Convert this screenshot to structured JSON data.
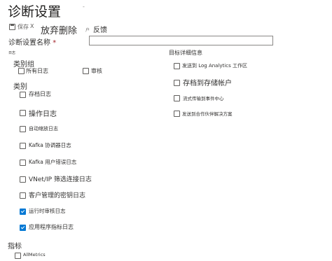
{
  "header": {
    "title": "诊断设置",
    "close_glyph": "-"
  },
  "toolbar": {
    "save_label": "保存",
    "discard_x": "X",
    "discard_label": "放弃删除",
    "delete_extra": "户",
    "feedback_label": "反馈"
  },
  "form": {
    "name_label": "诊断设置名称",
    "required_mark": "*",
    "name_value": ""
  },
  "logs": {
    "section_label": "日志",
    "category_groups_label": "类别组",
    "category_groups": [
      {
        "label": "所有日志",
        "checked": false
      },
      {
        "label": "审核",
        "checked": false
      }
    ],
    "categories_label": "类别",
    "categories": [
      {
        "label": "存档日志",
        "checked": false
      },
      {
        "label": "操作日志",
        "checked": false
      },
      {
        "label": "自动缩放日志",
        "checked": false
      },
      {
        "label": "Kafka 协调器日志",
        "checked": false
      },
      {
        "label": "Kafka 用户错误日志",
        "checked": false
      },
      {
        "label": "VNet/IP 筛选连接日志",
        "checked": false
      },
      {
        "label": "客户管理的密钥日志",
        "checked": false
      },
      {
        "label": "运行时审核日志",
        "checked": true
      },
      {
        "label": "应用程序指标日志",
        "checked": true
      }
    ]
  },
  "destination": {
    "section_label": "目标详细信息",
    "options": [
      {
        "label": "发送到 Log Analytics 工作区",
        "checked": false
      },
      {
        "label": "存档到存储帐户",
        "checked": false
      },
      {
        "label": "流式传输到事件中心",
        "checked": false
      },
      {
        "label": "发送到合作伙伴解决方案",
        "checked": false
      }
    ]
  },
  "metrics": {
    "section_label": "指标",
    "options": [
      {
        "label": "AllMetrics",
        "checked": false
      }
    ]
  },
  "colors": {
    "accent": "#0078d4",
    "required": "#a4262c",
    "text": "#323130"
  }
}
